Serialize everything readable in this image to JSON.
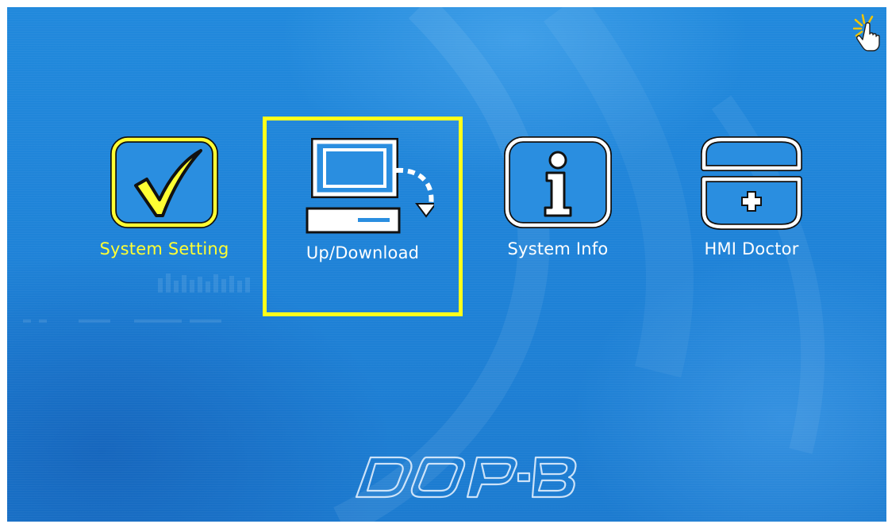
{
  "menu": {
    "items": [
      {
        "label": "System Setting",
        "icon": "checkmark-icon",
        "state": "highlighted"
      },
      {
        "label": "Up/Download",
        "icon": "computer-download-icon",
        "state": "selected"
      },
      {
        "label": "System Info",
        "icon": "info-icon",
        "state": "normal"
      },
      {
        "label": "HMI Doctor",
        "icon": "medical-kit-icon",
        "state": "normal"
      }
    ]
  },
  "logo": {
    "text": "DOP-B"
  },
  "cursor": {
    "icon": "pointer-hand-click-icon"
  },
  "colors": {
    "background": "#1f82d9",
    "highlight": "#ffff33",
    "selection_frame": "#ffff1a",
    "icon_stroke": "#ffffff",
    "icon_fill": "#2a8ee0"
  }
}
